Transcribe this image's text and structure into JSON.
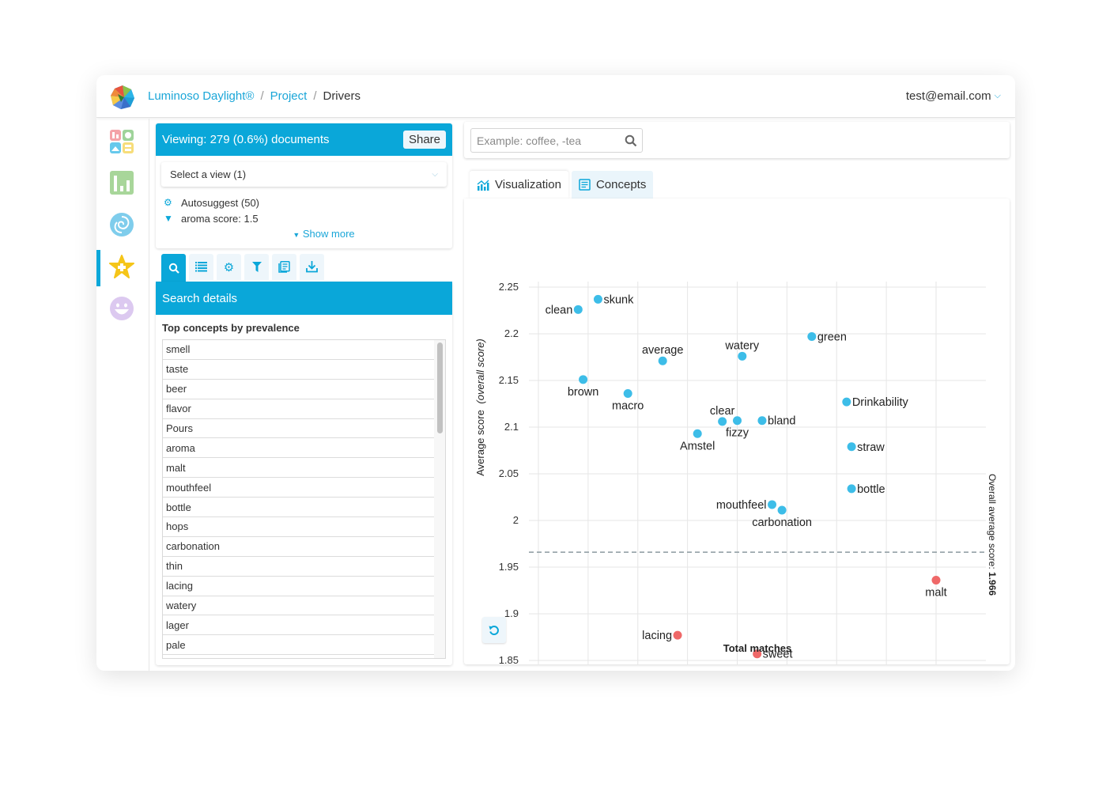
{
  "header": {
    "breadcrumb": [
      {
        "label": "Luminoso Daylight®",
        "link": true
      },
      {
        "label": "Project",
        "link": true
      },
      {
        "label": "Drivers",
        "link": false
      }
    ],
    "separator": "/",
    "user_email": "test@email.com"
  },
  "sidebar": {
    "items": [
      {
        "icon": "dashboard-icon",
        "active": false
      },
      {
        "icon": "bar-chart-icon",
        "active": false
      },
      {
        "icon": "galaxy-icon",
        "active": false
      },
      {
        "icon": "star-icon",
        "active": true
      },
      {
        "icon": "smiley-icon",
        "active": false
      }
    ]
  },
  "viewing": {
    "title": "Viewing: 279 (0.6%) documents",
    "share_label": "Share",
    "select_view": "Select a view (1)",
    "filters": [
      {
        "icon": "gear-icon",
        "label": "Autosuggest (50)"
      },
      {
        "icon": "filter-icon",
        "label": "aroma score: 1.5"
      }
    ],
    "show_more": "Show more"
  },
  "tool_tabs": [
    {
      "icon": "search-icon",
      "active": true
    },
    {
      "icon": "list-icon",
      "active": false
    },
    {
      "icon": "gear-icon",
      "active": false
    },
    {
      "icon": "filter-icon",
      "active": false
    },
    {
      "icon": "documents-icon",
      "active": false
    },
    {
      "icon": "download-icon",
      "active": false
    }
  ],
  "search_details": {
    "title": "Search details",
    "subtitle": "Top concepts by prevalence",
    "concepts": [
      "smell",
      "taste",
      "beer",
      "flavor",
      "Pours",
      "aroma",
      "malt",
      "mouthfeel",
      "bottle",
      "hops",
      "carbonation",
      "thin",
      "lacing",
      "watery",
      "lager",
      "pale"
    ]
  },
  "search": {
    "placeholder": "Example: coffee, -tea",
    "value": ""
  },
  "view_tabs": [
    {
      "label": "Visualization",
      "icon": "chart-icon",
      "active": true
    },
    {
      "label": "Concepts",
      "icon": "list-doc-icon",
      "active": false
    }
  ],
  "colors": {
    "accent": "#0aa7d9",
    "point_above": "#3dbde8",
    "point_below": "#ef6868",
    "grid": "#e6e6e6",
    "avg_line": "#8c9aa0"
  },
  "chart_data": {
    "type": "scatter",
    "title": "",
    "xlabel": "Total matches",
    "ylabel": "Average score",
    "ylabel_italic": "(overall score)",
    "xlim": [
      35,
      130
    ],
    "ylim": [
      1.82,
      2.26
    ],
    "x_ticks": [
      40,
      50,
      60,
      70,
      80,
      90,
      100,
      110,
      120
    ],
    "y_ticks": [
      1.85,
      1.9,
      1.95,
      2,
      2.05,
      2.1,
      2.15,
      2.2,
      2.25
    ],
    "y_tick_labels": [
      "1.85",
      "1.9",
      "1.95",
      "2",
      "2.05",
      "2.1",
      "2.15",
      "2.2",
      "2.25"
    ],
    "grid": true,
    "reference_line": {
      "value": 1.966,
      "label": "Overall average score: ",
      "value_label": "1.966",
      "style": "dashed"
    },
    "points": [
      {
        "label": "clean",
        "x": 48,
        "y": 2.226,
        "group": "above",
        "label_pos": "left"
      },
      {
        "label": "skunk",
        "x": 52,
        "y": 2.237,
        "group": "above",
        "label_pos": "right"
      },
      {
        "label": "average",
        "x": 65,
        "y": 2.171,
        "group": "above",
        "label_pos": "top"
      },
      {
        "label": "watery",
        "x": 81,
        "y": 2.176,
        "group": "above",
        "label_pos": "top"
      },
      {
        "label": "green",
        "x": 95,
        "y": 2.197,
        "group": "above",
        "label_pos": "right"
      },
      {
        "label": "brown",
        "x": 49,
        "y": 2.151,
        "group": "above",
        "label_pos": "bottom"
      },
      {
        "label": "macro",
        "x": 58,
        "y": 2.136,
        "group": "above",
        "label_pos": "bottom"
      },
      {
        "label": "clear",
        "x": 77,
        "y": 2.106,
        "group": "above",
        "label_pos": "top"
      },
      {
        "label": "fizzy",
        "x": 80,
        "y": 2.107,
        "group": "above",
        "label_pos": "bottom"
      },
      {
        "label": "bland",
        "x": 85,
        "y": 2.107,
        "group": "above",
        "label_pos": "right"
      },
      {
        "label": "Drinkability",
        "x": 102,
        "y": 2.127,
        "group": "above",
        "label_pos": "right"
      },
      {
        "label": "Amstel",
        "x": 72,
        "y": 2.093,
        "group": "above",
        "label_pos": "bottom"
      },
      {
        "label": "straw",
        "x": 103,
        "y": 2.079,
        "group": "above",
        "label_pos": "right"
      },
      {
        "label": "bottle",
        "x": 103,
        "y": 2.034,
        "group": "above",
        "label_pos": "right"
      },
      {
        "label": "mouthfeel",
        "x": 87,
        "y": 2.017,
        "group": "above",
        "label_pos": "left"
      },
      {
        "label": "carbonation",
        "x": 89,
        "y": 2.011,
        "group": "above",
        "label_pos": "bottom"
      },
      {
        "label": "malt",
        "x": 120,
        "y": 1.936,
        "group": "below",
        "label_pos": "bottom"
      },
      {
        "label": "lacing",
        "x": 68,
        "y": 1.877,
        "group": "below",
        "label_pos": "left"
      },
      {
        "label": "sweet",
        "x": 84,
        "y": 1.857,
        "group": "below",
        "label_pos": "right"
      }
    ]
  }
}
